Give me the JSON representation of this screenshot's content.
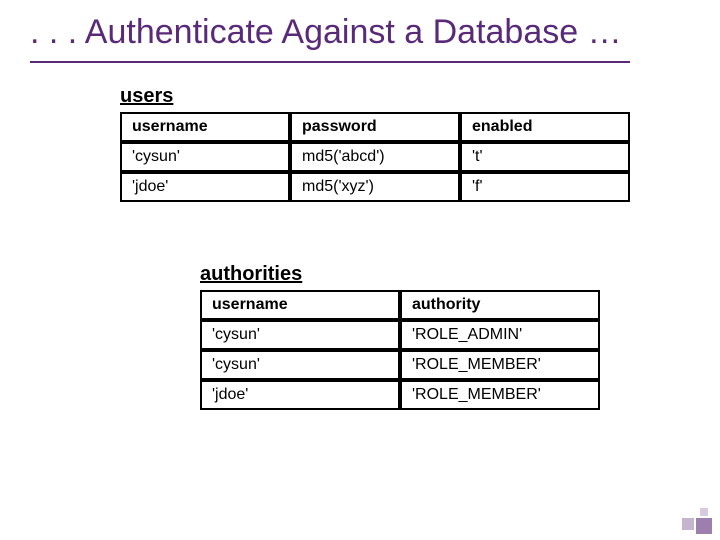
{
  "title": ". . . Authenticate Against a Database …",
  "tables": {
    "users": {
      "name": "users",
      "columns": [
        "username",
        "password",
        "enabled"
      ],
      "rows": [
        {
          "c0": "'cysun'",
          "c1": "md5('abcd')",
          "c2": "'t'"
        },
        {
          "c0": "'jdoe'",
          "c1": "md5('xyz')",
          "c2": "'f'"
        }
      ]
    },
    "authorities": {
      "name": "authorities",
      "columns": [
        "username",
        "authority"
      ],
      "rows": [
        {
          "c0": "'cysun'",
          "c1": "'ROLE_ADMIN'"
        },
        {
          "c0": "'cysun'",
          "c1": "'ROLE_MEMBER'"
        },
        {
          "c0": "'jdoe'",
          "c1": "'ROLE_MEMBER'"
        }
      ]
    }
  }
}
